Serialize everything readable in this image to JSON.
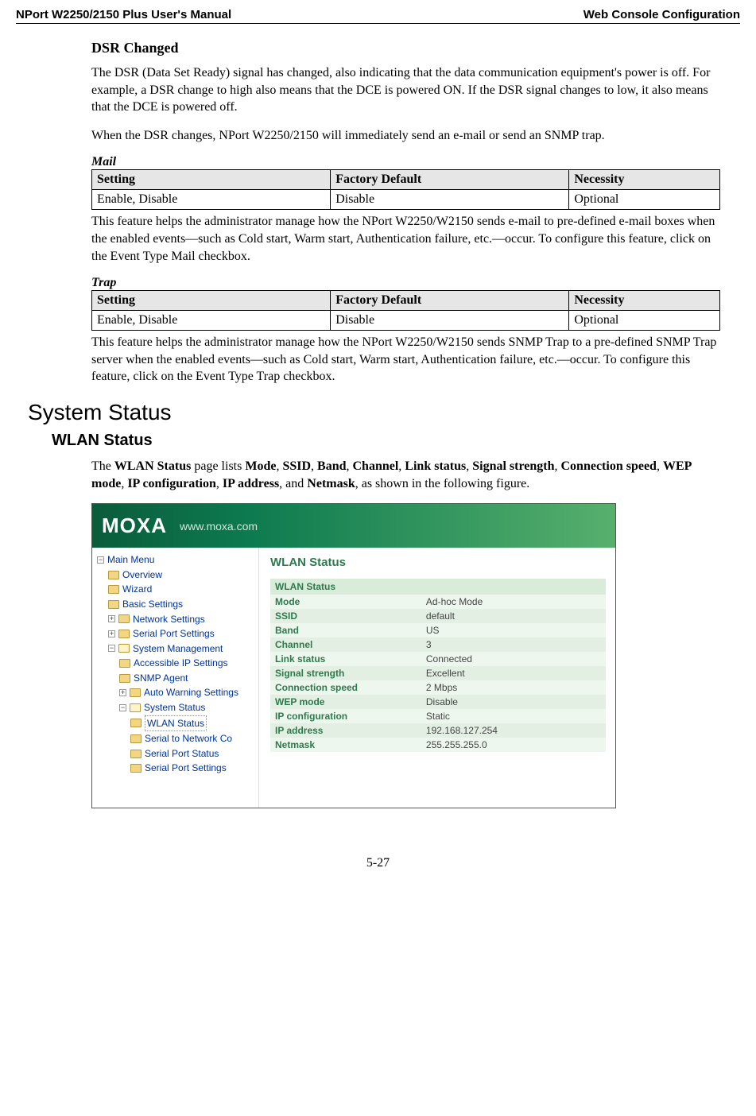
{
  "header": {
    "left": "NPort W2250/2150 Plus User's Manual",
    "right": "Web Console Configuration"
  },
  "dsr": {
    "heading": "DSR Changed",
    "para1": "The DSR (Data Set Ready) signal has changed, also indicating that the data communication equipment's power is off. For example, a DSR change to high also means that the DCE is powered ON. If the DSR signal changes to low, it also means that the DCE is powered off.",
    "para2": "When the DSR changes, NPort W2250/2150 will immediately send an e-mail or send an SNMP trap."
  },
  "mail": {
    "title": "Mail",
    "headers": {
      "setting": "Setting",
      "default": "Factory Default",
      "necessity": "Necessity"
    },
    "row": {
      "setting": "Enable, Disable",
      "default": "Disable",
      "necessity": "Optional"
    },
    "desc": "This feature helps the administrator manage how the NPort W2250/W2150 sends e-mail to pre-defined e-mail boxes when the enabled events—such as Cold start, Warm start, Authentication failure, etc.—occur. To configure this feature, click on the Event Type Mail checkbox."
  },
  "trap": {
    "title": "Trap",
    "headers": {
      "setting": "Setting",
      "default": "Factory Default",
      "necessity": "Necessity"
    },
    "row": {
      "setting": "Enable, Disable",
      "default": "Disable",
      "necessity": "Optional"
    },
    "desc": "This feature helps the administrator manage how the NPort W2250/W2150 sends SNMP Trap to a pre-defined SNMP Trap server when the enabled events—such as Cold start, Warm start, Authentication failure, etc.—occur. To configure this feature, click on the Event Type Trap checkbox."
  },
  "system_status": {
    "heading": "System Status",
    "wlan_heading": "WLAN Status",
    "intro_parts": {
      "pre": "The ",
      "b1": "WLAN Status",
      "t1": " page lists ",
      "b2": "Mode",
      "b3": "SSID",
      "b4": "Band",
      "b5": "Channel",
      "b6": "Link status",
      "b7": "Signal strength",
      "b8": "Connection speed",
      "b9": "WEP mode",
      "b10": "IP configuration",
      "b11": "IP address",
      "t_and": ", and ",
      "b12": "Netmask",
      "post": ", as shown in the following figure."
    }
  },
  "screenshot": {
    "logo": "MOXA",
    "url": "www.moxa.com",
    "tree": {
      "root": "Main Menu",
      "items": [
        "Overview",
        "Wizard",
        "Basic Settings",
        "Network Settings",
        "Serial Port Settings",
        "System Management"
      ],
      "sm_children": [
        "Accessible IP Settings",
        "SNMP Agent",
        "Auto Warning Settings",
        "System Status"
      ],
      "ss_children": [
        "WLAN Status",
        "Serial to Network Co",
        "Serial Port Status",
        "Serial Port Settings"
      ]
    },
    "panel": {
      "title": "WLAN Status",
      "group": "WLAN Status",
      "rows": [
        {
          "k": "Mode",
          "v": "Ad-hoc Mode"
        },
        {
          "k": "SSID",
          "v": "default"
        },
        {
          "k": "Band",
          "v": "US"
        },
        {
          "k": "Channel",
          "v": "3"
        },
        {
          "k": "Link status",
          "v": "Connected"
        },
        {
          "k": "Signal strength",
          "v": "Excellent"
        },
        {
          "k": "Connection speed",
          "v": "2 Mbps"
        },
        {
          "k": "WEP mode",
          "v": "Disable"
        },
        {
          "k": "IP configuration",
          "v": "Static"
        },
        {
          "k": "IP address",
          "v": "192.168.127.254"
        },
        {
          "k": "Netmask",
          "v": "255.255.255.0"
        }
      ]
    }
  },
  "page_number": "5-27"
}
